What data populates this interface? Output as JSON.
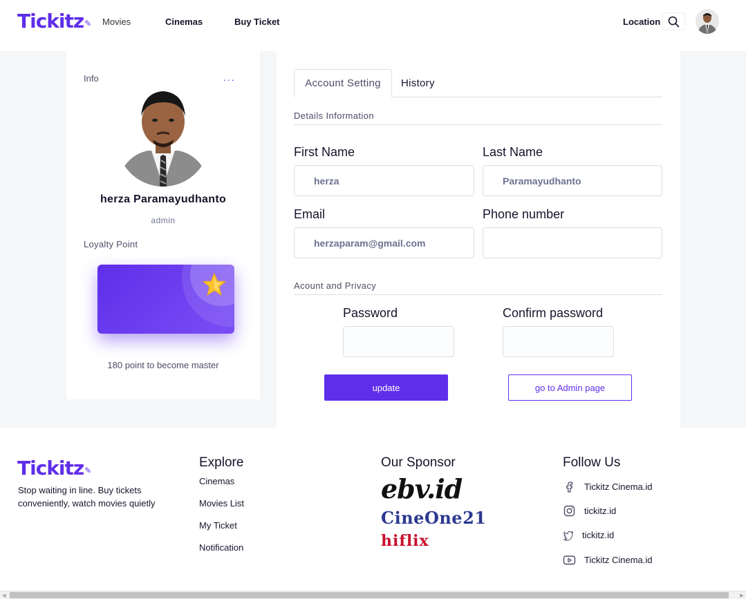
{
  "brand": {
    "name": "Tickitz",
    "color": "#5f2eea"
  },
  "nav": {
    "movies": "Movies",
    "cinemas": "Cinemas",
    "buy_ticket": "Buy Ticket",
    "location": "Location"
  },
  "info": {
    "label": "Info",
    "menu": "...",
    "name": "herza Paramayudhanto",
    "role": "admin",
    "loyalty_label": "Loyalty Point",
    "loyalty_text": "180 point to become master"
  },
  "settings": {
    "tabs": [
      "Account Setting",
      "History"
    ],
    "details_title": "Details Information",
    "first_name_label": "First Name",
    "first_name_value": "herza",
    "last_name_label": "Last Name",
    "last_name_value": "Paramayudhanto",
    "email_label": "Email",
    "email_value": "herzaparam@gmail.com",
    "phone_label": "Phone number",
    "phone_value": "",
    "privacy_title": "Acount and Privacy",
    "password_label": "Password",
    "confirm_password_label": "Confirm password",
    "update_button": "update",
    "admin_button": "go to Admin page"
  },
  "footer": {
    "tagline": "Stop waiting in line. Buy tickets conveniently, watch movies quietly",
    "explore_heading": "Explore",
    "explore_links": [
      "Cinemas",
      "Movies List",
      "My Ticket",
      "Notification"
    ],
    "sponsor_heading": "Our Sponsor",
    "sponsors": [
      "ebv.id",
      "CineOne21",
      "hiflix"
    ],
    "follow_heading": "Follow Us",
    "socials": [
      {
        "icon": "facebook-icon",
        "label": "Tickitz Cinema.id"
      },
      {
        "icon": "instagram-icon",
        "label": "tickitz.id"
      },
      {
        "icon": "twitter-icon",
        "label": "tickitz.id"
      },
      {
        "icon": "youtube-icon",
        "label": "Tickitz Cinema.id"
      }
    ]
  }
}
